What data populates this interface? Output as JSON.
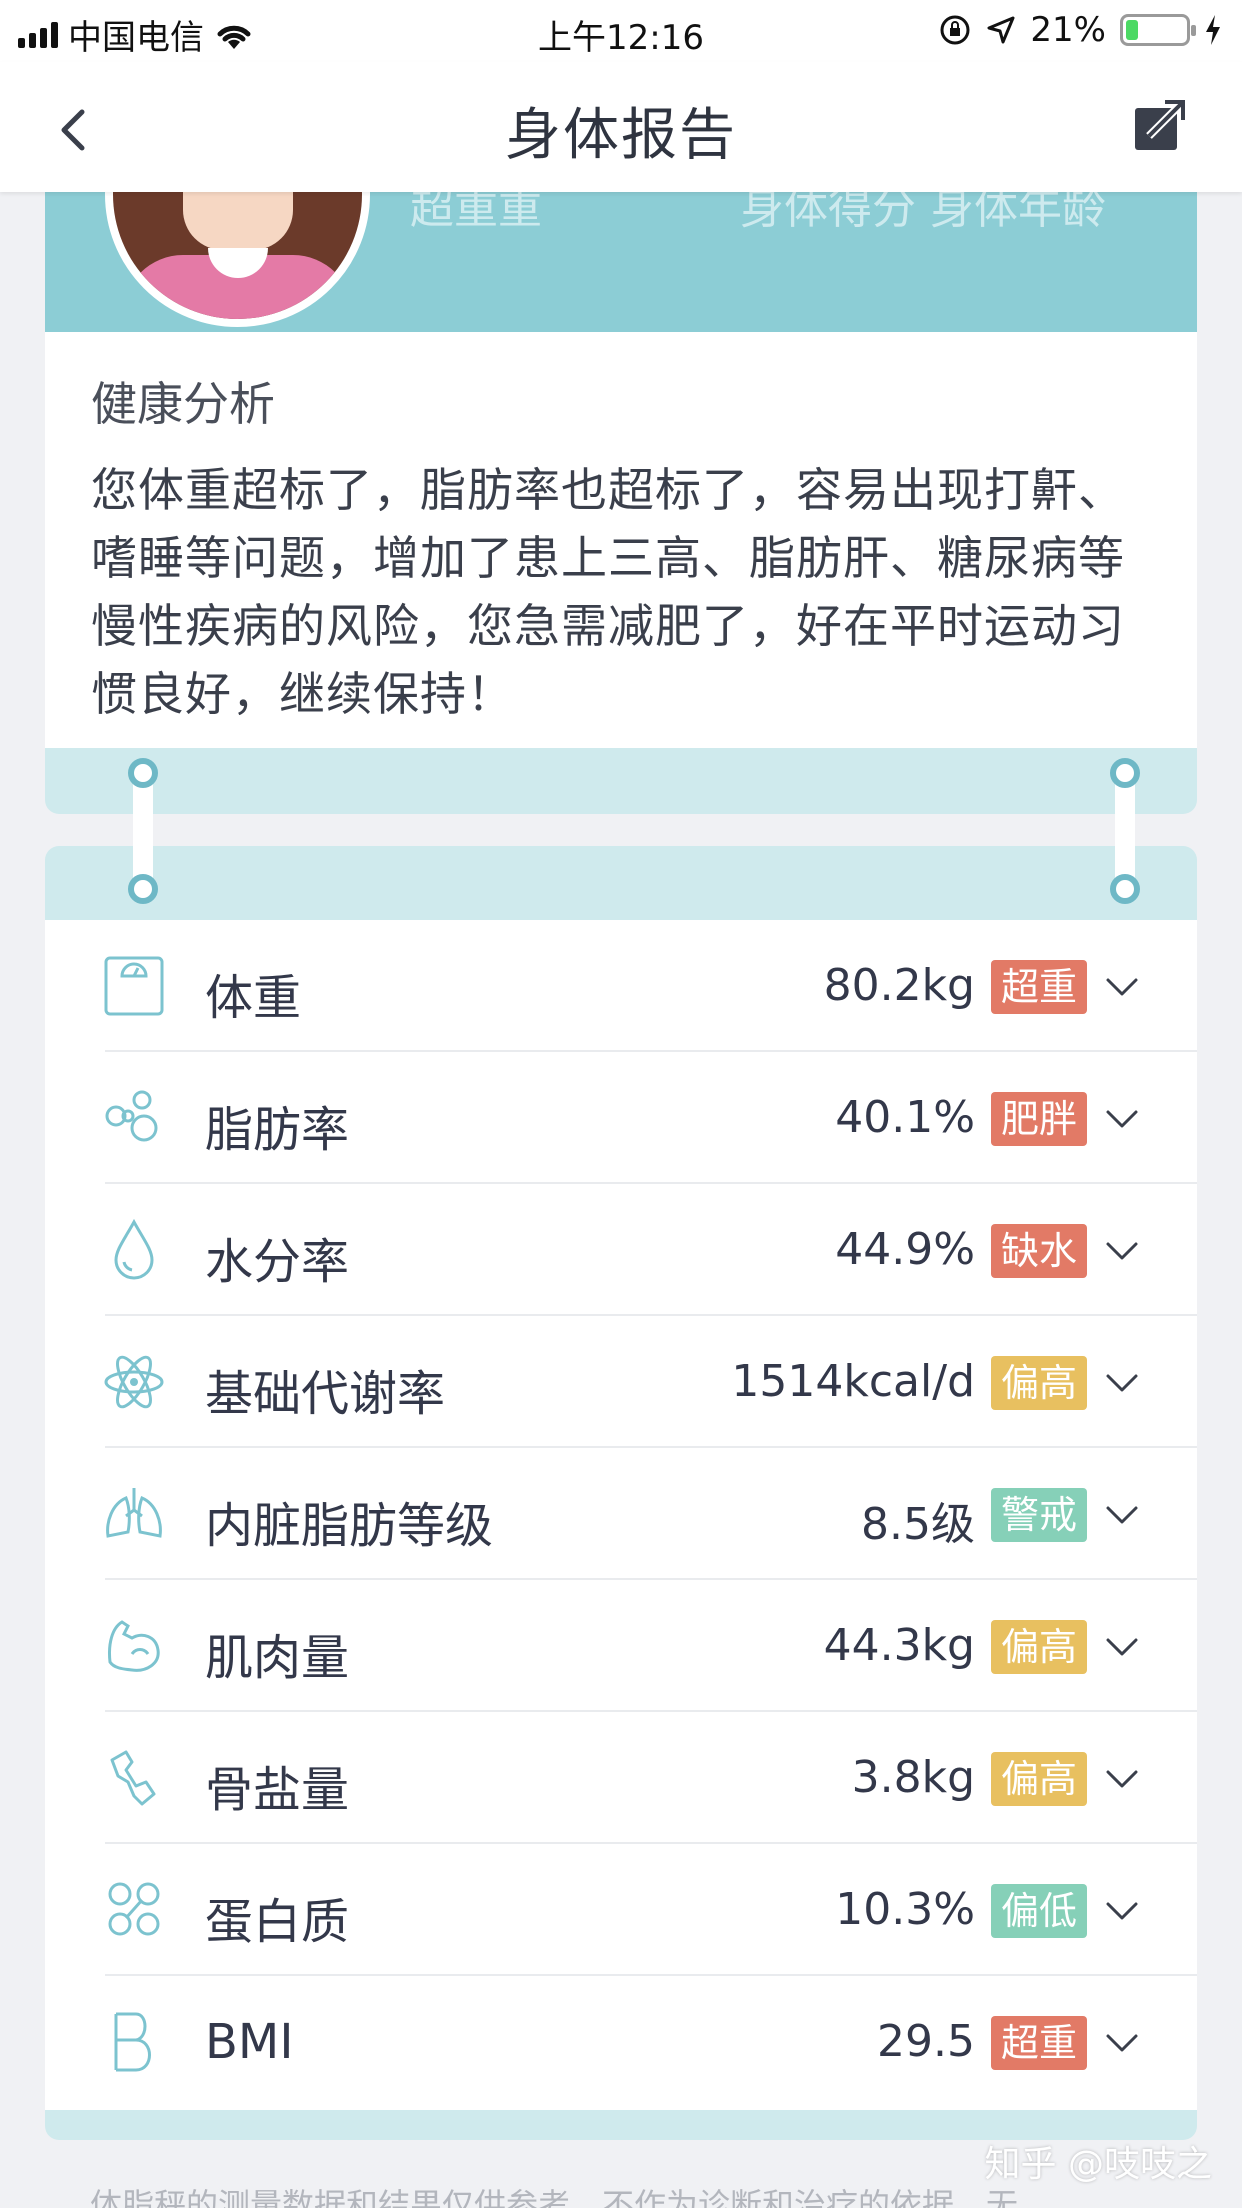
{
  "status_bar": {
    "carrier": "中国电信",
    "time": "上午12:16",
    "battery": "21%"
  },
  "nav": {
    "title": "身体报告",
    "back_icon": "chevron-left-icon",
    "share_icon": "share-external-icon"
  },
  "profile": {
    "faded_left": "超重重",
    "faded_right": "身体得分  身体年龄"
  },
  "analysis": {
    "title": "健康分析",
    "text": "您体重超标了，脂肪率也超标了，容易出现打鼾、嗜睡等问题，增加了患上三高、脂肪肝、糖尿病等慢性疾病的风险，您急需减肥了，好在平时运动习惯良好，继续保持！"
  },
  "colors": {
    "red": "#e27a66",
    "yellow": "#e8c060",
    "green": "#86d0b8",
    "teal": "#8ccdd5"
  },
  "metrics": [
    {
      "icon": "scale-icon",
      "label": "体重",
      "value": "80.2kg",
      "badge": "超重",
      "badge_color": "#e27a66"
    },
    {
      "icon": "fat-cells-icon",
      "label": "脂肪率",
      "value": "40.1%",
      "badge": "肥胖",
      "badge_color": "#e27a66"
    },
    {
      "icon": "water-drop-icon",
      "label": "水分率",
      "value": "44.9%",
      "badge": "缺水",
      "badge_color": "#e27a66"
    },
    {
      "icon": "atom-icon",
      "label": "基础代谢率",
      "value": "1514kcal/d",
      "badge": "偏高",
      "badge_color": "#e8c060"
    },
    {
      "icon": "lungs-icon",
      "label": "内脏脂肪等级",
      "value": "8.5级",
      "badge": "警戒",
      "badge_color": "#86d0b8"
    },
    {
      "icon": "muscle-icon",
      "label": "肌肉量",
      "value": "44.3kg",
      "badge": "偏高",
      "badge_color": "#e8c060"
    },
    {
      "icon": "bone-icon",
      "label": "骨盐量",
      "value": "3.8kg",
      "badge": "偏高",
      "badge_color": "#e8c060"
    },
    {
      "icon": "protein-icon",
      "label": "蛋白质",
      "value": "10.3%",
      "badge": "偏低",
      "badge_color": "#86d0b8"
    },
    {
      "icon": "bmi-icon",
      "label": "BMI",
      "value": "29.5",
      "badge": "超重",
      "badge_color": "#e27a66"
    }
  ],
  "footer": {
    "disclaimer": "体脂秤的测量数据和结果仅供参考，不作为诊断和治疗的依据，无",
    "watermark": "知乎 @吱吱之"
  }
}
